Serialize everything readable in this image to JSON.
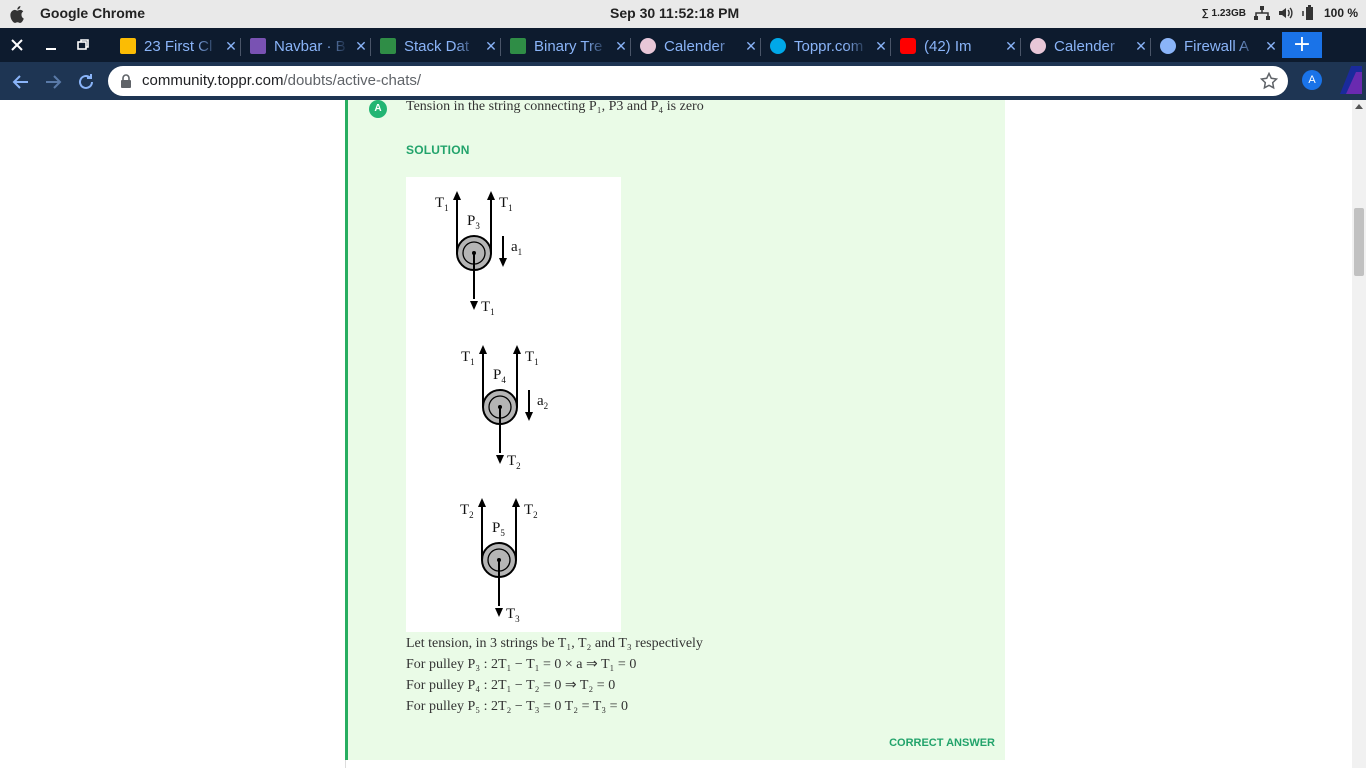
{
  "os_bar": {
    "app_name": "Google Chrome",
    "datetime": "Sep 30  11:52:18 PM",
    "memory": "∑ 1.23GB",
    "battery": "100 %"
  },
  "tabs": [
    {
      "title": "23 First Cl",
      "icon": "google-drive-icon",
      "color": "#fbbc04"
    },
    {
      "title": "Navbar · B",
      "icon": "bootstrap-icon",
      "color": "#7952b3"
    },
    {
      "title": "Stack Dat",
      "icon": "geeksforgeeks-icon",
      "color": "#2f8d46"
    },
    {
      "title": "Binary Tre",
      "icon": "geeksforgeeks-icon",
      "color": "#2f8d46"
    },
    {
      "title": "Calender",
      "icon": "calendar-app-icon",
      "color": "#e8c7d8"
    },
    {
      "title": "Toppr.com",
      "icon": "toppr-icon",
      "color": "#00a8e8"
    },
    {
      "title": "(42) Im",
      "icon": "youtube-icon",
      "color": "#ff0000"
    },
    {
      "title": "Calender",
      "icon": "calendar-app-icon",
      "color": "#e8c7d8"
    },
    {
      "title": "Firewall A",
      "icon": "globe-icon",
      "color": "#8ab4f8"
    }
  ],
  "new_tab_label": "+",
  "address": {
    "domain": "community.toppr.com",
    "path": "/doubts/active-chats/"
  },
  "profile_initial": "A",
  "option": {
    "badge": "A",
    "text": "Tension in the string connecting P₁, P3 and P₄ is zero"
  },
  "solution_label": "SOLUTION",
  "diagram": {
    "pulleys": [
      {
        "name": "P3",
        "left_label": "T",
        "left_sub": "1",
        "right_label": "T",
        "right_sub": "1",
        "name_label": "P",
        "name_sub": "3",
        "acc_label": "a",
        "acc_sub": "1",
        "bottom_label": "T",
        "bottom_sub": "1"
      },
      {
        "name": "P4",
        "left_label": "T",
        "left_sub": "1",
        "right_label": "T",
        "right_sub": "1",
        "name_label": "P",
        "name_sub": "4",
        "acc_label": "a",
        "acc_sub": "2",
        "bottom_label": "T",
        "bottom_sub": "2"
      },
      {
        "name": "P5",
        "left_label": "T",
        "left_sub": "2",
        "right_label": "T",
        "right_sub": "2",
        "name_label": "P",
        "name_sub": "5",
        "acc_label": "",
        "acc_sub": "",
        "bottom_label": "T",
        "bottom_sub": "3"
      }
    ]
  },
  "solution_lines": [
    "Let tension, in 3 strings be T₁, T₂ and T₃ respectively",
    "For pulley P₃ : 2T₁ − T₁ = 0 × a ⇒ T₁ = 0",
    "For pulley P₄ : 2T₁ − T₂ = 0 ⇒ T₂ = 0",
    "For pulley P₅ : 2T₂ − T₃ = 0 T₂ = T₃ = 0"
  ],
  "correct_label": "CORRECT ANSWER",
  "colors": {
    "card_bg": "#eafbe7",
    "accent_green": "#22a36b",
    "tab_strip": "#0d1b2e",
    "toolbar": "#1e3553"
  }
}
